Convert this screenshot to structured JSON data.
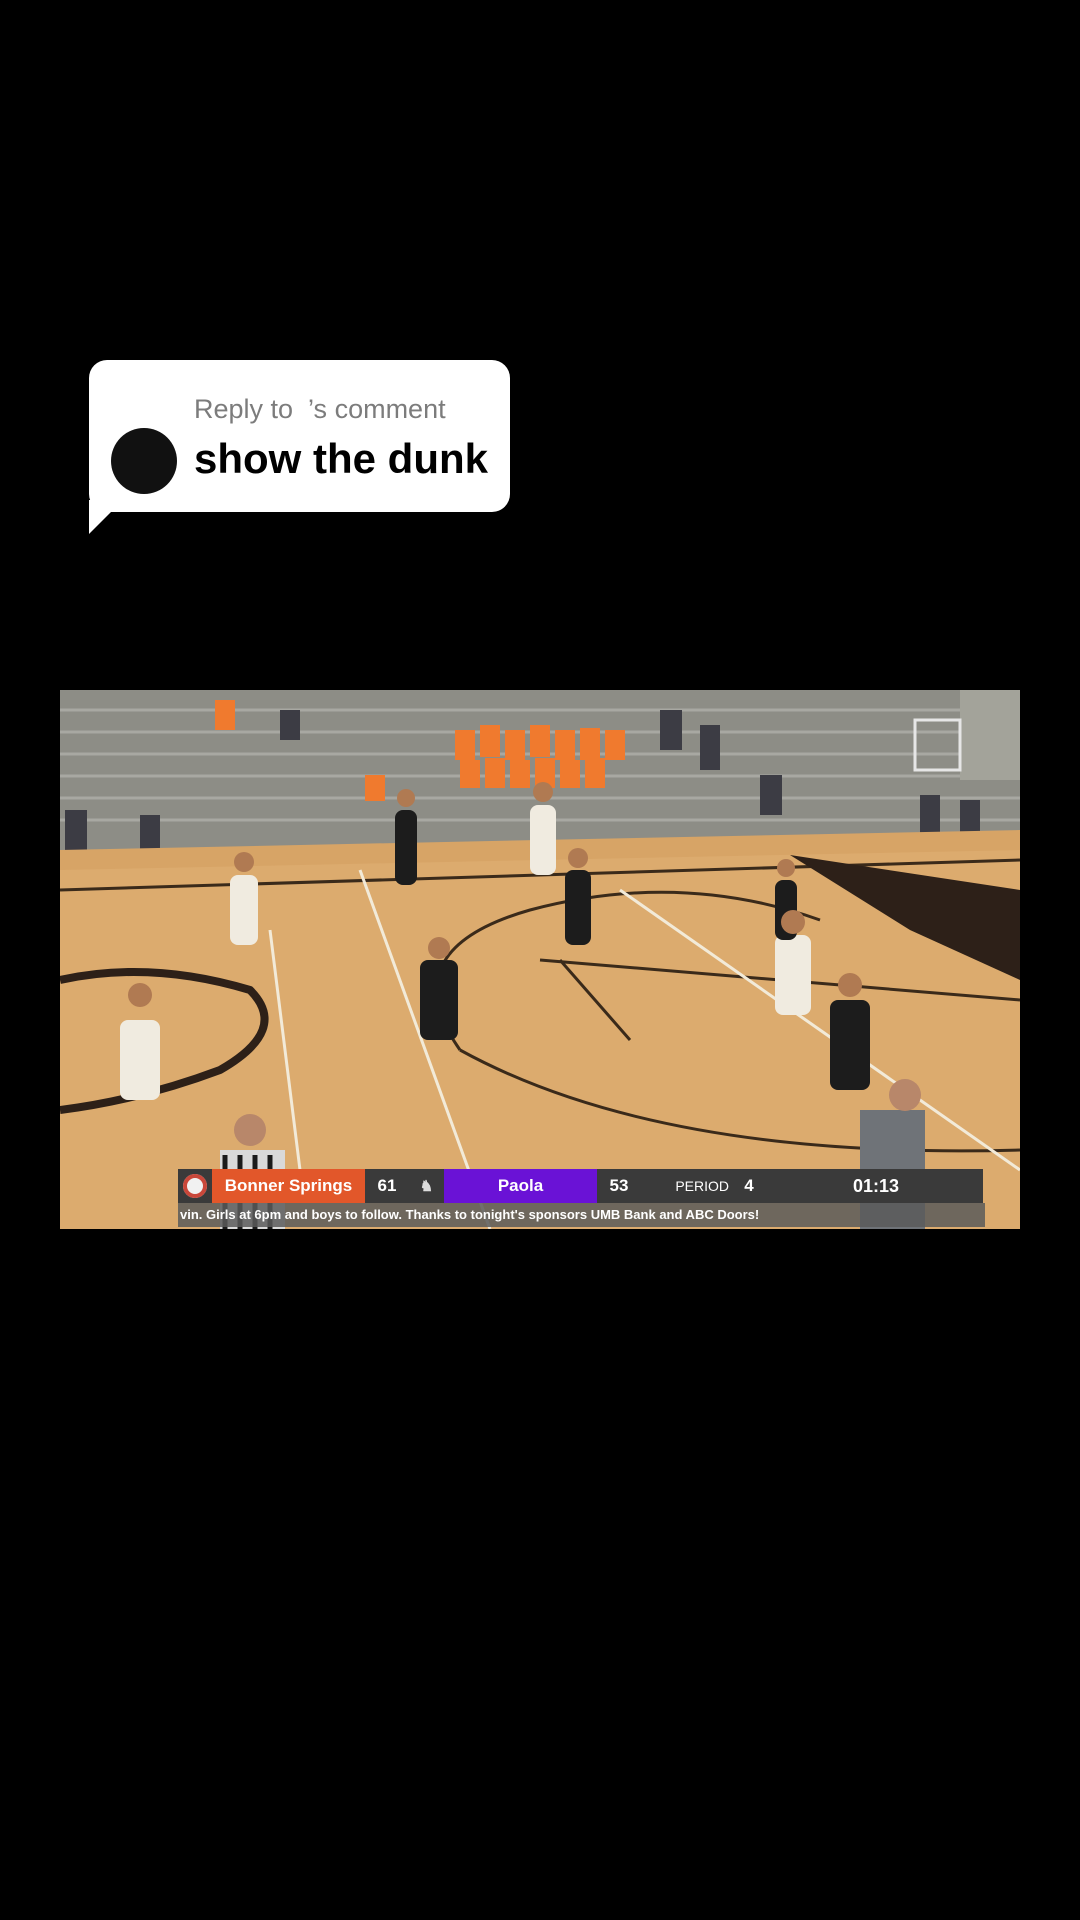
{
  "reply": {
    "header": "Reply to  ’s comment",
    "comment": "show the dunk"
  },
  "video": {
    "scoreboard": {
      "home_team": "Bonner Springs",
      "home_score": "61",
      "away_team": "Paola",
      "away_score": "53",
      "period_label": "PERIOD",
      "period": "4",
      "clock": "01:13",
      "home_color": "#e2572a",
      "away_color": "#6a12d6"
    },
    "ticker": "vin.  Girls at 6pm and boys to follow.  Thanks to tonight's sponsors UMB Bank and  ABC Doors!"
  }
}
